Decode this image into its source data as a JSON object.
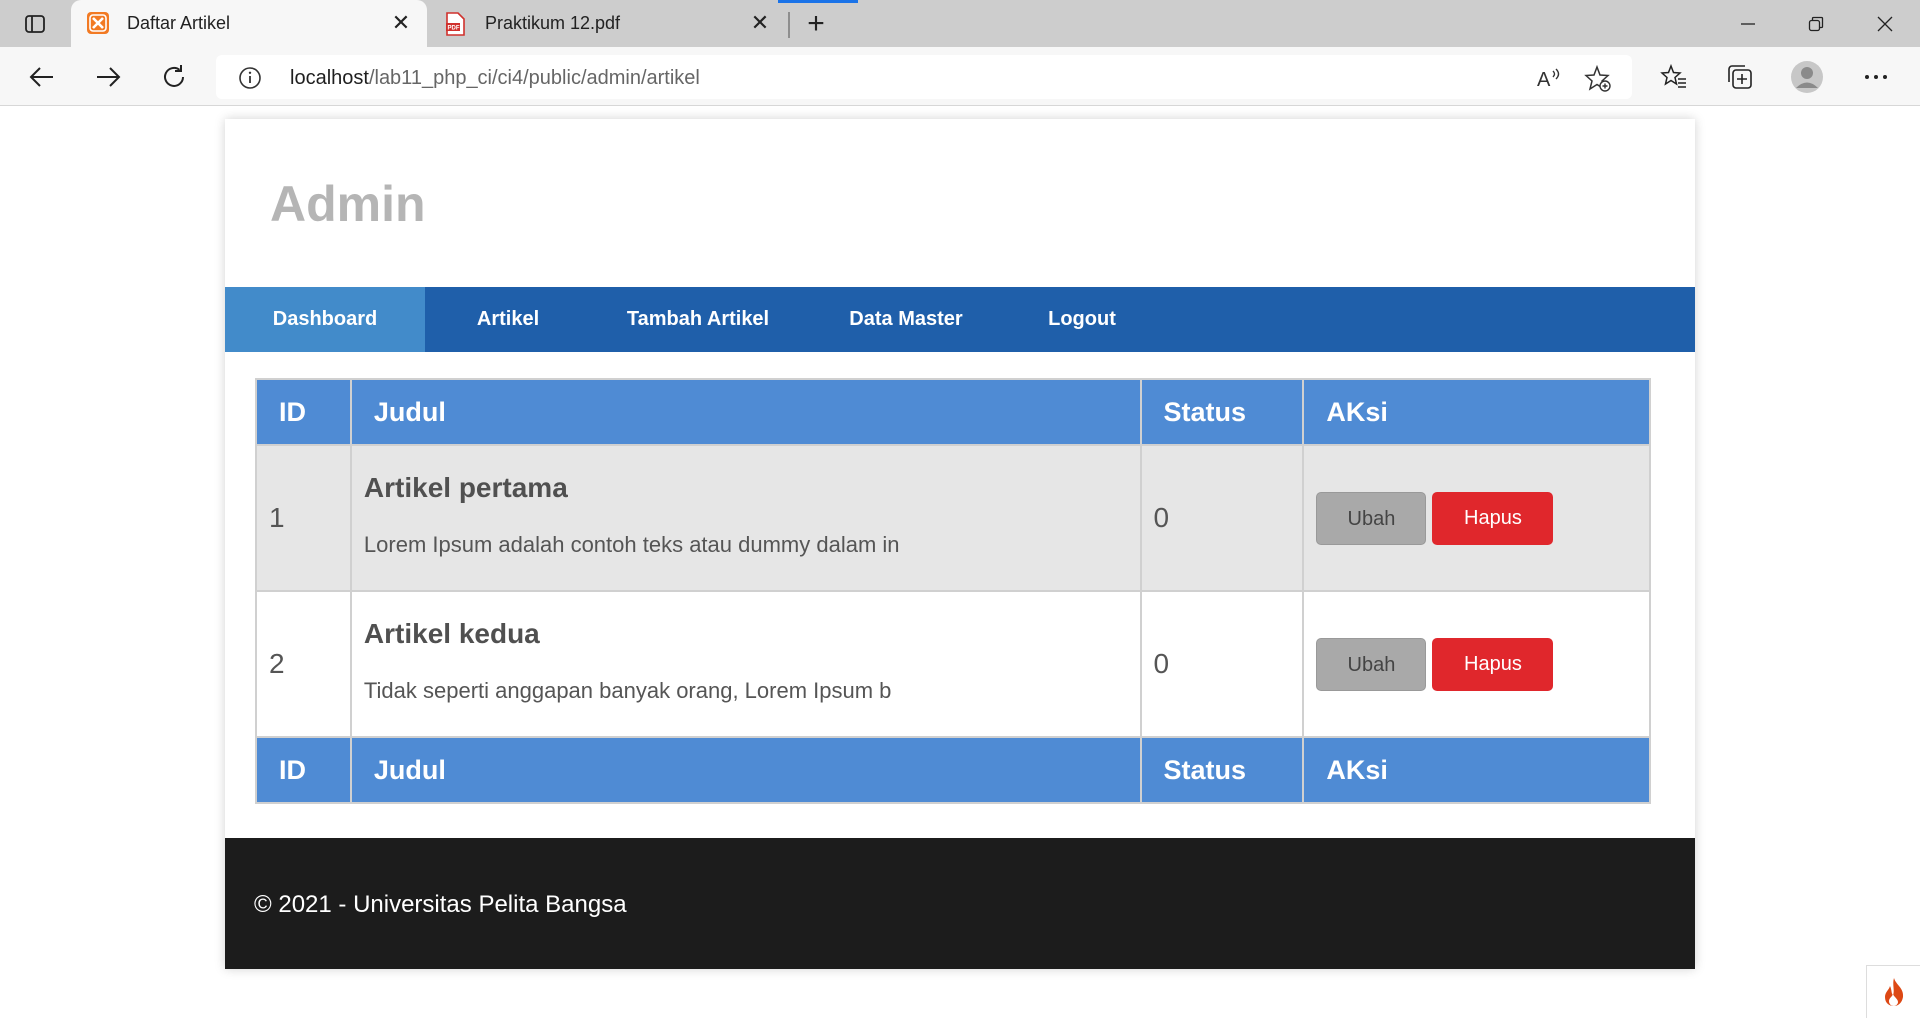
{
  "browser": {
    "tabs": [
      {
        "title": "Daftar Artikel",
        "icon": "xampp-icon",
        "active": true
      },
      {
        "title": "Praktikum 12.pdf",
        "icon": "pdf-icon",
        "active": false
      }
    ],
    "url_host": "localhost",
    "url_path": "/lab11_php_ci/ci4/public/admin/artikel"
  },
  "site": {
    "title": "Admin"
  },
  "menu": {
    "items": [
      {
        "label": "Dashboard",
        "active": true
      },
      {
        "label": "Artikel"
      },
      {
        "label": "Tambah Artikel"
      },
      {
        "label": "Data Master"
      },
      {
        "label": "Logout"
      }
    ]
  },
  "table": {
    "headers": [
      "ID",
      "Judul",
      "Status",
      "AKsi"
    ],
    "rows": [
      {
        "id": "1",
        "title": "Artikel pertama",
        "excerpt": "Lorem Ipsum adalah contoh teks atau dummy dalam in",
        "status": "0",
        "edit": "Ubah",
        "delete": "Hapus"
      },
      {
        "id": "2",
        "title": "Artikel kedua",
        "excerpt": "Tidak seperti anggapan banyak orang, Lorem Ipsum b",
        "status": "0",
        "edit": "Ubah",
        "delete": "Hapus"
      }
    ]
  },
  "footer": {
    "text": "© 2021 - Universitas Pelita Bangsa"
  },
  "colors": {
    "menu": "#1f5faa",
    "menu_active": "#428bca",
    "table_header": "#4f8bd4",
    "delete": "#e0272c",
    "footer": "#1c1c1c"
  }
}
